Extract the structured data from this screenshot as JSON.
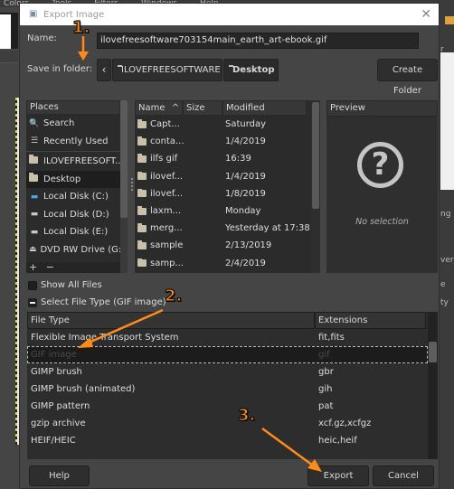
{
  "background": {
    "menu_items": [
      "Colors",
      "Tools",
      "Filters",
      "Windows",
      "Help"
    ],
    "right_fragments": [
      "r",
      "ng",
      "ver",
      "e",
      "ty"
    ]
  },
  "dialog": {
    "title": "Export Image",
    "name_label": "Name:",
    "name_value": "ilovefreesoftware703154main_earth_art-ebook.gif",
    "folder_label": "Save in folder:",
    "path": [
      {
        "label": "ILOVEFREESOFTWARE",
        "active": false
      },
      {
        "label": "Desktop",
        "active": true
      }
    ],
    "create_folder_label": "Create Folder",
    "places": {
      "header": "Places",
      "items": [
        {
          "label": "Search",
          "icon": "search-icon"
        },
        {
          "label": "Recently Used",
          "icon": "recent-icon"
        },
        {
          "label": "ILOVEFREESOFT...",
          "icon": "folder-icon"
        },
        {
          "label": "Desktop",
          "icon": "folder-icon",
          "selected": true
        },
        {
          "label": "Local Disk (C:)",
          "icon": "drive-icon"
        },
        {
          "label": "Local Disk (D:)",
          "icon": "drive-icon"
        },
        {
          "label": "Local Disk (E:)",
          "icon": "drive-icon"
        },
        {
          "label": "DVD RW Drive (G:)",
          "icon": "dvd-drive-icon"
        }
      ],
      "add_label": "+",
      "remove_label": "−"
    },
    "files": {
      "columns": {
        "name": "Name",
        "size": "Size",
        "modified": "Modified"
      },
      "sort_indicator": "^",
      "rows": [
        {
          "name": "Capt...",
          "modified": "Saturday"
        },
        {
          "name": "conta...",
          "modified": "1/4/2019"
        },
        {
          "name": "ilfs gif",
          "modified": "16:39"
        },
        {
          "name": "ilovef...",
          "modified": "1/4/2019"
        },
        {
          "name": "ilovef...",
          "modified": "1/8/2019"
        },
        {
          "name": "laxm...",
          "modified": "Monday"
        },
        {
          "name": "merg...",
          "modified": "Yesterday at 17:38"
        },
        {
          "name": "sample",
          "modified": "2/13/2019"
        },
        {
          "name": "samp...",
          "modified": "2/4/2019"
        }
      ]
    },
    "preview": {
      "header": "Preview",
      "icon": "question-icon",
      "empty_text": "No selection"
    },
    "show_all_files_label": "Show All Files",
    "show_all_files_checked": false,
    "select_file_type_label": "Select File Type (GIF image)",
    "file_types": {
      "columns": {
        "type": "File Type",
        "extensions": "Extensions"
      },
      "rows": [
        {
          "type": "Flexible Image Transport System",
          "ext": "fit,fits"
        },
        {
          "type": "GIF image",
          "ext": "gif",
          "selected": true
        },
        {
          "type": "GIMP brush",
          "ext": "gbr"
        },
        {
          "type": "GIMP brush (animated)",
          "ext": "gih"
        },
        {
          "type": "GIMP pattern",
          "ext": "pat"
        },
        {
          "type": "gzip archive",
          "ext": "xcf.gz,xcfgz"
        },
        {
          "type": "HEIF/HEIC",
          "ext": "heic,heif"
        }
      ]
    },
    "buttons": {
      "help": "Help",
      "export": "Export",
      "cancel": "Cancel"
    }
  },
  "annotations": {
    "step1": "1.",
    "step2": "2.",
    "step3": "3.",
    "color": "#ff8c1a"
  }
}
